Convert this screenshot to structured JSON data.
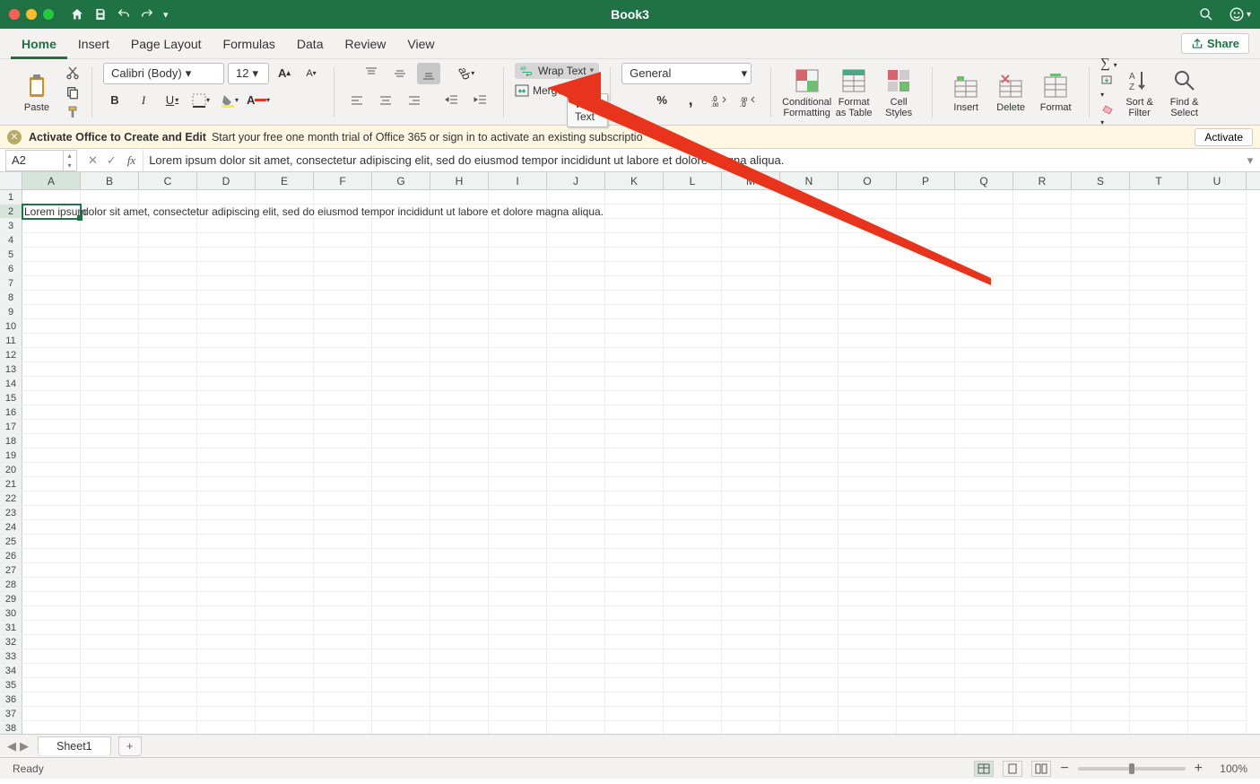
{
  "titlebar": {
    "title": "Book3"
  },
  "tabs": [
    "Home",
    "Insert",
    "Page Layout",
    "Formulas",
    "Data",
    "Review",
    "View"
  ],
  "share_label": "Share",
  "ribbon": {
    "paste_label": "Paste",
    "font_name": "Calibri (Body)",
    "font_size": "12",
    "wrap_text_label": "Wrap Text",
    "wrap_text_tooltip": "Wrap Text",
    "merge_label": "Merge &",
    "number_format": "General",
    "cond_fmt": "Conditional\nFormatting",
    "fmt_table": "Format\nas Table",
    "cell_styles": "Cell\nStyles",
    "insert": "Insert",
    "delete": "Delete",
    "format": "Format",
    "sort_filter": "Sort &\nFilter",
    "find_select": "Find &\nSelect"
  },
  "activation": {
    "title": "Activate Office to Create and Edit",
    "msg": "Start your free one month trial of Office 365 or sign in to activate an existing subscriptio",
    "btn": "Activate"
  },
  "namebox": "A2",
  "formula": "Lorem ipsum dolor sit amet, consectetur adipiscing elit, sed do eiusmod tempor incididunt ut labore et dolore magna aliqua.",
  "columns": [
    "A",
    "B",
    "C",
    "D",
    "E",
    "F",
    "G",
    "H",
    "I",
    "J",
    "K",
    "L",
    "M",
    "N",
    "O",
    "P",
    "Q",
    "R",
    "S",
    "T",
    "U"
  ],
  "cell_a2_display_clip": "Lorem ipsum",
  "cell_a2_overflow": "dolor sit amet, consectetur adipiscing elit, sed do eiusmod tempor incididunt ut labore et dolore magna aliqua.",
  "sheet_tab": "Sheet1",
  "status": {
    "ready": "Ready",
    "zoom": "100%"
  }
}
